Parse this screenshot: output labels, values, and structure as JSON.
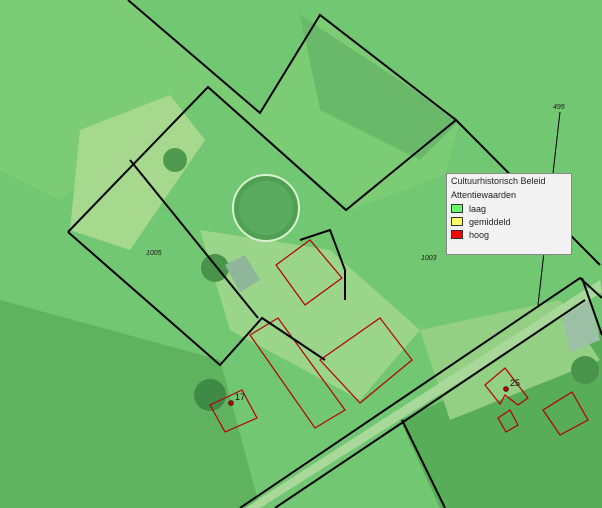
{
  "legend": {
    "title": "Cultuurhistorisch Beleid",
    "subtitle": "Attentiewaarden",
    "items": [
      {
        "label": "laag",
        "color": "#66ff66"
      },
      {
        "label": "gemiddeld",
        "color": "#ffff66"
      },
      {
        "label": "hoog",
        "color": "#ff0000"
      }
    ]
  },
  "parcel_labels": [
    "1005",
    "1003",
    "495"
  ],
  "house_numbers": [
    "17",
    "25"
  ]
}
